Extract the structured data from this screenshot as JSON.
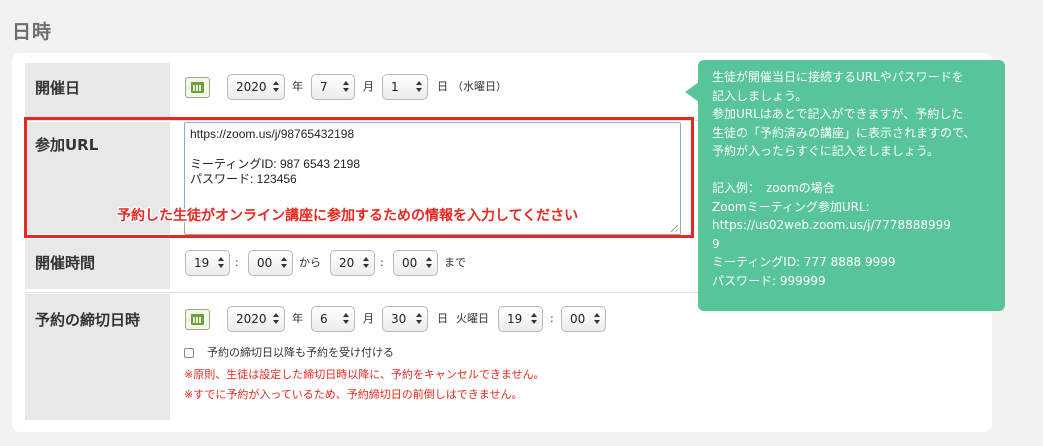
{
  "section_title": "日時",
  "rows": {
    "date": {
      "label": "開催日",
      "year": "2020",
      "year_unit": "年",
      "month": "7",
      "month_unit": "月",
      "day": "1",
      "day_unit": "日",
      "weekday": "（水曜日）"
    },
    "url": {
      "label": "参加URL",
      "lines": [
        "https://zoom.us/j/98765432198",
        "",
        "ミーティングID: 987 6543 2198",
        "パスワード: 123456"
      ],
      "instruction": "予約した生徒がオンライン講座に参加するための情報を入力してください"
    },
    "time": {
      "label": "開催時間",
      "start_hour": "19",
      "start_min": "00",
      "from": "から",
      "end_hour": "20",
      "end_min": "00",
      "until": "まで",
      "colon": ":"
    },
    "deadline": {
      "label": "予約の締切日時",
      "year": "2020",
      "year_unit": "年",
      "month": "6",
      "month_unit": "月",
      "day": "30",
      "day_unit": "日",
      "weekday": "火曜日",
      "hour": "19",
      "min": "00",
      "colon": ":",
      "checkbox_label": "予約の締切日以降も予約を受け付ける",
      "note1": "※原則、生徒は設定した締切日時以降に、予約をキャンセルできません。",
      "note2": "※すでに予約が入っているため、予約締切日の前倒しはできません。"
    }
  },
  "tooltip": {
    "lines": [
      "生徒が開催当日に接続するURLやパスワードを",
      "記入しましょう。",
      "参加URLはあとで記入ができますが、予約した",
      "生徒の「予約済みの講座」に表示されますので、",
      "予約が入ったらすぐに記入をしましょう。",
      "",
      "記入例：　zoomの場合",
      "Zoomミーティング参加URL:",
      "https://us02web.zoom.us/j/7778888999",
      "9",
      "ミーティングID: 777 8888 9999",
      "パスワード: 999999"
    ]
  },
  "colors": {
    "accent_red": "#e8281e",
    "tooltip_green": "#57c49a"
  },
  "icons": {
    "calendar": "calendar-icon"
  }
}
